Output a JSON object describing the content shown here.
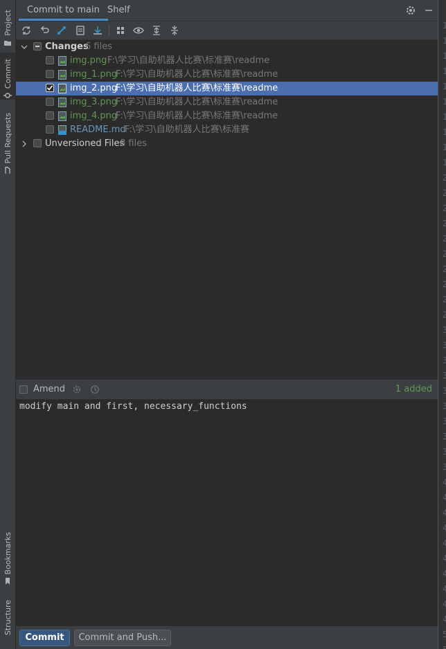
{
  "left_stripe": {
    "project": "Project",
    "commit": "Commit",
    "pull_requests": "Pull Requests",
    "bookmarks": "Bookmarks",
    "structure": "Structure"
  },
  "tabs": {
    "commit_to": "Commit to main",
    "shelf": "Shelf"
  },
  "tree": {
    "changes_label": "Changes",
    "changes_count": "6 files",
    "files": [
      {
        "name": "img.png",
        "path": "F:\\学习\\自助机器人比赛\\标准赛\\readme",
        "checked": false,
        "color": "#629755"
      },
      {
        "name": "img_1.png",
        "path": "F:\\学习\\自助机器人比赛\\标准赛\\readme",
        "checked": false,
        "color": "#629755"
      },
      {
        "name": "img_2.png",
        "path": "F:\\学习\\自助机器人比赛\\标准赛\\readme",
        "checked": true,
        "color": "#ffffff"
      },
      {
        "name": "img_3.png",
        "path": "F:\\学习\\自助机器人比赛\\标准赛\\readme",
        "checked": false,
        "color": "#629755"
      },
      {
        "name": "img_4.png",
        "path": "F:\\学习\\自助机器人比赛\\标准赛\\readme",
        "checked": false,
        "color": "#629755"
      },
      {
        "name": "README.md",
        "path": "F:\\学习\\自助机器人比赛\\标准赛",
        "checked": false,
        "color": "#6897bb"
      }
    ],
    "unversioned_label": "Unversioned Files",
    "unversioned_count": "8 files"
  },
  "amend": {
    "label": "Amend",
    "status": "1 added"
  },
  "message": "modify main and first, necessary_functions",
  "buttons": {
    "commit": "Commit",
    "commit_and_push": "Commit and Push..."
  },
  "gutter_numbers": [
    "1",
    "1",
    "1",
    "1",
    "1",
    "1",
    "1",
    "1",
    "1",
    "1",
    "2",
    "2",
    "2",
    "2",
    "2",
    "2",
    "2",
    "2",
    "2",
    "2",
    "3",
    "3",
    "3",
    "3",
    "3",
    "3",
    "3",
    "3",
    "3",
    "3",
    "4",
    "4",
    "4",
    "4",
    "4",
    "4",
    "4",
    "4",
    "4",
    "4",
    "5",
    "5"
  ],
  "colors": {
    "selection": "#4b6eaf",
    "added_green": "#629755",
    "modified_blue": "#6897bb",
    "primary_button": "#365880"
  }
}
